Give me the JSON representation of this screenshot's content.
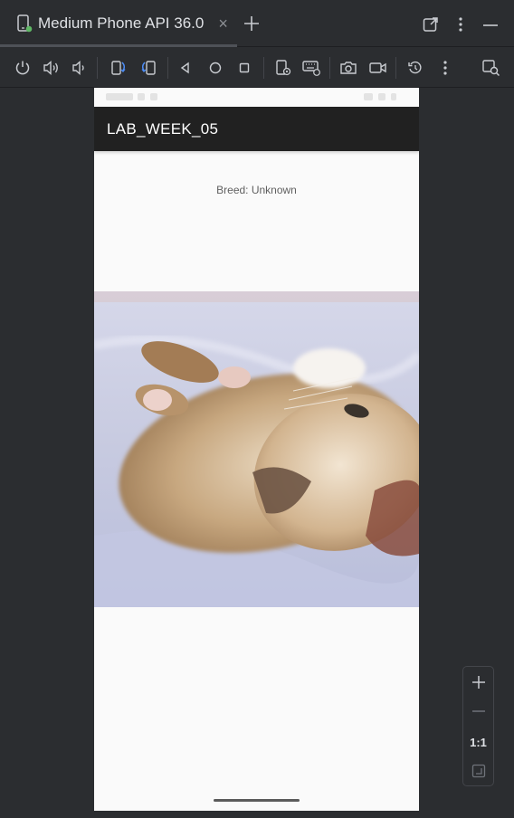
{
  "emulator": {
    "tab_title": "Medium Phone API 36.0",
    "tab_close": "×"
  },
  "toolbar": {
    "icons": [
      "power-icon",
      "volume-up-icon",
      "volume-down-icon",
      "rotate-left-icon",
      "rotate-right-icon",
      "back-icon",
      "home-icon",
      "overview-icon",
      "device-settings-icon",
      "keyboard-icon",
      "screenshot-icon",
      "screen-record-icon",
      "snapshot-icon",
      "more-icon",
      "layout-inspector-icon"
    ]
  },
  "app": {
    "title": "LAB_WEEK_05",
    "breed_text": "Breed: Unknown",
    "appbar_color": "#212121",
    "background_color": "#fafafa"
  },
  "zoom": {
    "zoom_in": "+",
    "zoom_out": "—",
    "actual_size": "1:1"
  }
}
